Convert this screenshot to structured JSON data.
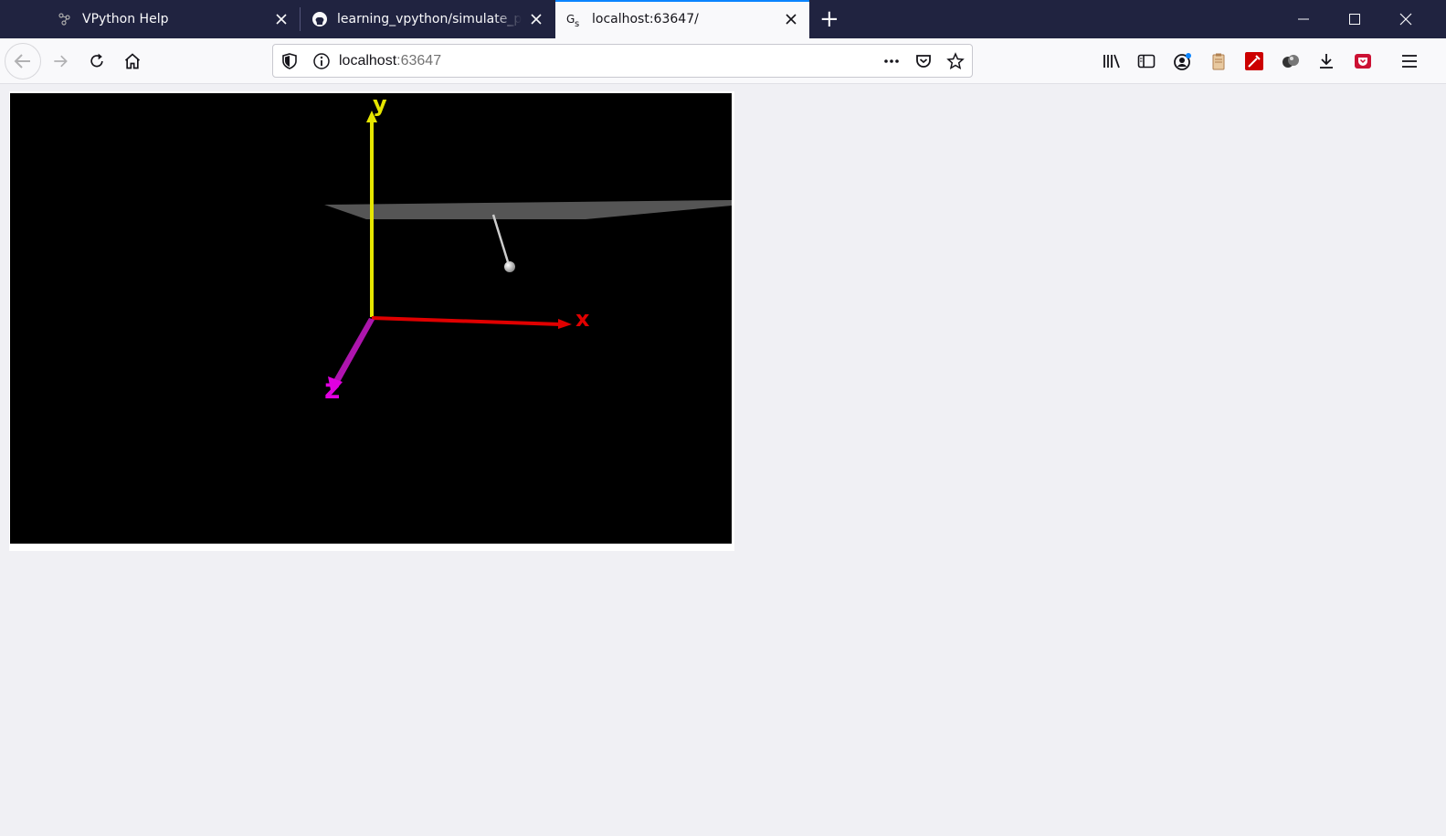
{
  "browser": {
    "tabs": [
      {
        "title": "VPython Help",
        "favicon": "vpython-icon",
        "active": false
      },
      {
        "title": "learning_vpython/simulate_pendulum",
        "favicon": "github-icon",
        "active": false
      },
      {
        "title": "localhost:63647/",
        "favicon": "gs-icon",
        "active": true
      }
    ],
    "new_tab_label": "+",
    "url": {
      "host": "localhost",
      "port": ":63647"
    }
  },
  "scene": {
    "axes": {
      "x_label": "x",
      "y_label": "y",
      "z_label": "z",
      "x_color": "#e00000",
      "y_color": "#e6e600",
      "z_color": "#c000c0"
    },
    "ceiling_color": "#555555",
    "rod_color": "#cccccc",
    "bob_color": "#e0e0e0",
    "background": "#000000"
  }
}
